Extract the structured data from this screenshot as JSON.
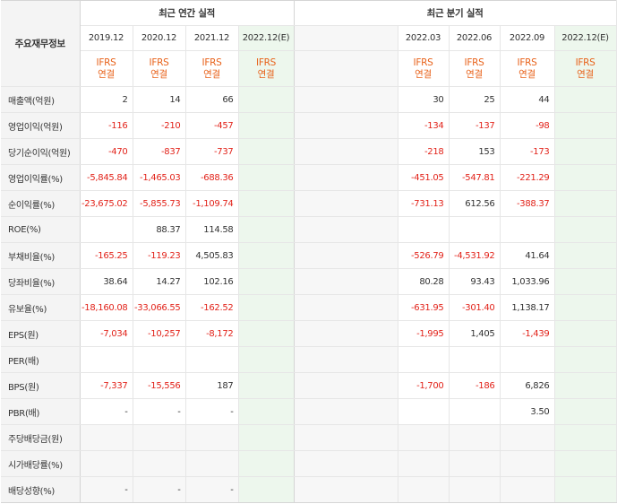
{
  "header": {
    "corner": "주요재무정보",
    "annual_title": "최근 연간 실적",
    "quarter_title": "최근 분기 실적",
    "annual_periods": [
      "2019.12",
      "2020.12",
      "2021.12",
      "2022.12(E)"
    ],
    "quarter_periods": [
      "2022.03",
      "2022.06",
      "2022.09",
      "2022.12(E)"
    ],
    "ifrs_line1": "IFRS",
    "ifrs_line2": "연결"
  },
  "rows": [
    {
      "label": "매출액(억원)",
      "annual": [
        "2",
        "14",
        "66",
        ""
      ],
      "quarter": [
        "30",
        "25",
        "44",
        ""
      ]
    },
    {
      "label": "영업이익(억원)",
      "annual": [
        "-116",
        "-210",
        "-457",
        ""
      ],
      "quarter": [
        "-134",
        "-137",
        "-98",
        ""
      ]
    },
    {
      "label": "당기순이익(억원)",
      "annual": [
        "-470",
        "-837",
        "-737",
        ""
      ],
      "quarter": [
        "-218",
        "153",
        "-173",
        ""
      ]
    },
    {
      "label": "영업이익률(%)",
      "annual": [
        "-5,845.84",
        "-1,465.03",
        "-688.36",
        ""
      ],
      "quarter": [
        "-451.05",
        "-547.81",
        "-221.29",
        ""
      ]
    },
    {
      "label": "순이익률(%)",
      "annual": [
        "-23,675.02",
        "-5,855.73",
        "-1,109.74",
        ""
      ],
      "quarter": [
        "-731.13",
        "612.56",
        "-388.37",
        ""
      ]
    },
    {
      "label": "ROE(%)",
      "annual": [
        "",
        "88.37",
        "114.58",
        ""
      ],
      "quarter": [
        "",
        "",
        "",
        ""
      ]
    },
    {
      "label": "부채비율(%)",
      "annual": [
        "-165.25",
        "-119.23",
        "4,505.83",
        ""
      ],
      "quarter": [
        "-526.79",
        "-4,531.92",
        "41.64",
        ""
      ]
    },
    {
      "label": "당좌비율(%)",
      "annual": [
        "38.64",
        "14.27",
        "102.16",
        ""
      ],
      "quarter": [
        "80.28",
        "93.43",
        "1,033.96",
        ""
      ]
    },
    {
      "label": "유보율(%)",
      "annual": [
        "-18,160.08",
        "-33,066.55",
        "-162.52",
        ""
      ],
      "quarter": [
        "-631.95",
        "-301.40",
        "1,138.17",
        ""
      ]
    },
    {
      "label": "EPS(원)",
      "annual": [
        "-7,034",
        "-10,257",
        "-8,172",
        ""
      ],
      "quarter": [
        "-1,995",
        "1,405",
        "-1,439",
        ""
      ]
    },
    {
      "label": "PER(배)",
      "annual": [
        "",
        "",
        "",
        ""
      ],
      "quarter": [
        "",
        "",
        "",
        ""
      ]
    },
    {
      "label": "BPS(원)",
      "annual": [
        "-7,337",
        "-15,556",
        "187",
        ""
      ],
      "quarter": [
        "-1,700",
        "-186",
        "6,826",
        ""
      ]
    },
    {
      "label": "PBR(배)",
      "annual": [
        "-",
        "-",
        "-",
        ""
      ],
      "quarter": [
        "",
        "",
        "3.50",
        ""
      ]
    },
    {
      "label": "주당배당금(원)",
      "annual": [
        "",
        "",
        "",
        ""
      ],
      "quarter": [
        "",
        "",
        "",
        ""
      ]
    },
    {
      "label": "시가배당률(%)",
      "annual": [
        "",
        "",
        "",
        ""
      ],
      "quarter": [
        "",
        "",
        "",
        ""
      ]
    },
    {
      "label": "배당성향(%)",
      "annual": [
        "-",
        "-",
        "-",
        ""
      ],
      "quarter": [
        "",
        "",
        "",
        ""
      ]
    }
  ],
  "colors": {
    "negative": "#e2231a",
    "ifrs": "#e8621a",
    "estimate_bg": "#edf7ed"
  }
}
